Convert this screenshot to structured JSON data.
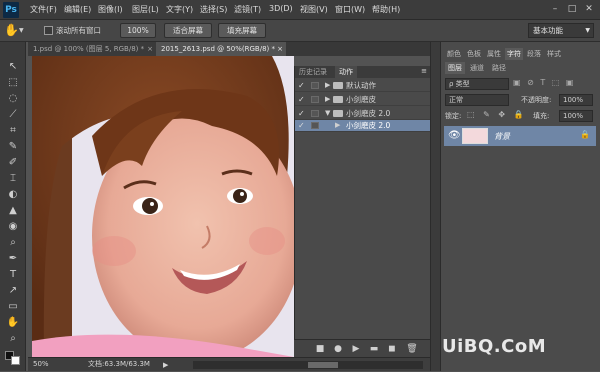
{
  "app": {
    "logo": "Ps"
  },
  "menu": [
    "文件(F)",
    "编辑(E)",
    "图像(I)",
    "图层(L)",
    "文字(Y)",
    "选择(S)",
    "滤镜(T)",
    "3D(D)",
    "视图(V)",
    "窗口(W)",
    "帮助(H)"
  ],
  "window_controls": {
    "minimize": "–",
    "maximize": "□",
    "close": "✕"
  },
  "options": {
    "scroll_all_label": "滚动所有窗口",
    "zoom_100": "100%",
    "fit_screen": "适合屏幕",
    "fill_screen": "填充屏幕",
    "workspace": "基本功能"
  },
  "tabs": [
    {
      "label": "1.psd @ 100% (图层 5, RGB/8) *"
    },
    {
      "label": "2015_2613.psd @ 50%(RGB/8) *"
    }
  ],
  "tools": [
    "↖",
    "⬚",
    "◌",
    "⟋",
    "⌗",
    "✎",
    "✐",
    "⌶",
    "◐",
    "▲",
    "◉",
    "⌕",
    "✒",
    "T",
    "↗",
    "▭",
    "✋",
    "⌕"
  ],
  "actions_panel": {
    "tabs": [
      "历史记录",
      "动作"
    ],
    "rows": [
      {
        "check": "✓",
        "arrow": "▶",
        "label": "默认动作"
      },
      {
        "check": "✓",
        "arrow": "▶",
        "label": "小剑磨皮"
      },
      {
        "check": "✓",
        "arrow": "▼",
        "label": "小剑磨皮 2.0"
      },
      {
        "check": "✓",
        "arrow": "▶",
        "label": "小剑磨皮 2.0"
      }
    ],
    "controls": [
      "■",
      "●",
      "▶",
      "▬",
      "◼",
      "🗑"
    ]
  },
  "right_panel": {
    "top_tabs": [
      "颜色",
      "色板",
      "属性",
      "字符",
      "段落",
      "样式"
    ],
    "sub_tabs": [
      "图层",
      "通道",
      "路径"
    ],
    "filter_label": "ρ 类型",
    "blend_mode": "正常",
    "opacity_label": "不透明度:",
    "opacity_value": "100%",
    "lock_label": "锁定:",
    "fill_label": "填充:",
    "fill_value": "100%",
    "layer_name": "背景"
  },
  "status": {
    "zoom": "50%",
    "doc_info": "文档:63.3M/63.3M"
  },
  "watermark": "UiBQ.CoM",
  "colors": {
    "menubar": "#3c3c3c",
    "panel": "#4a4a4a",
    "selected_row": "#6f86a6",
    "ps_blue": "#4ab6f0"
  }
}
